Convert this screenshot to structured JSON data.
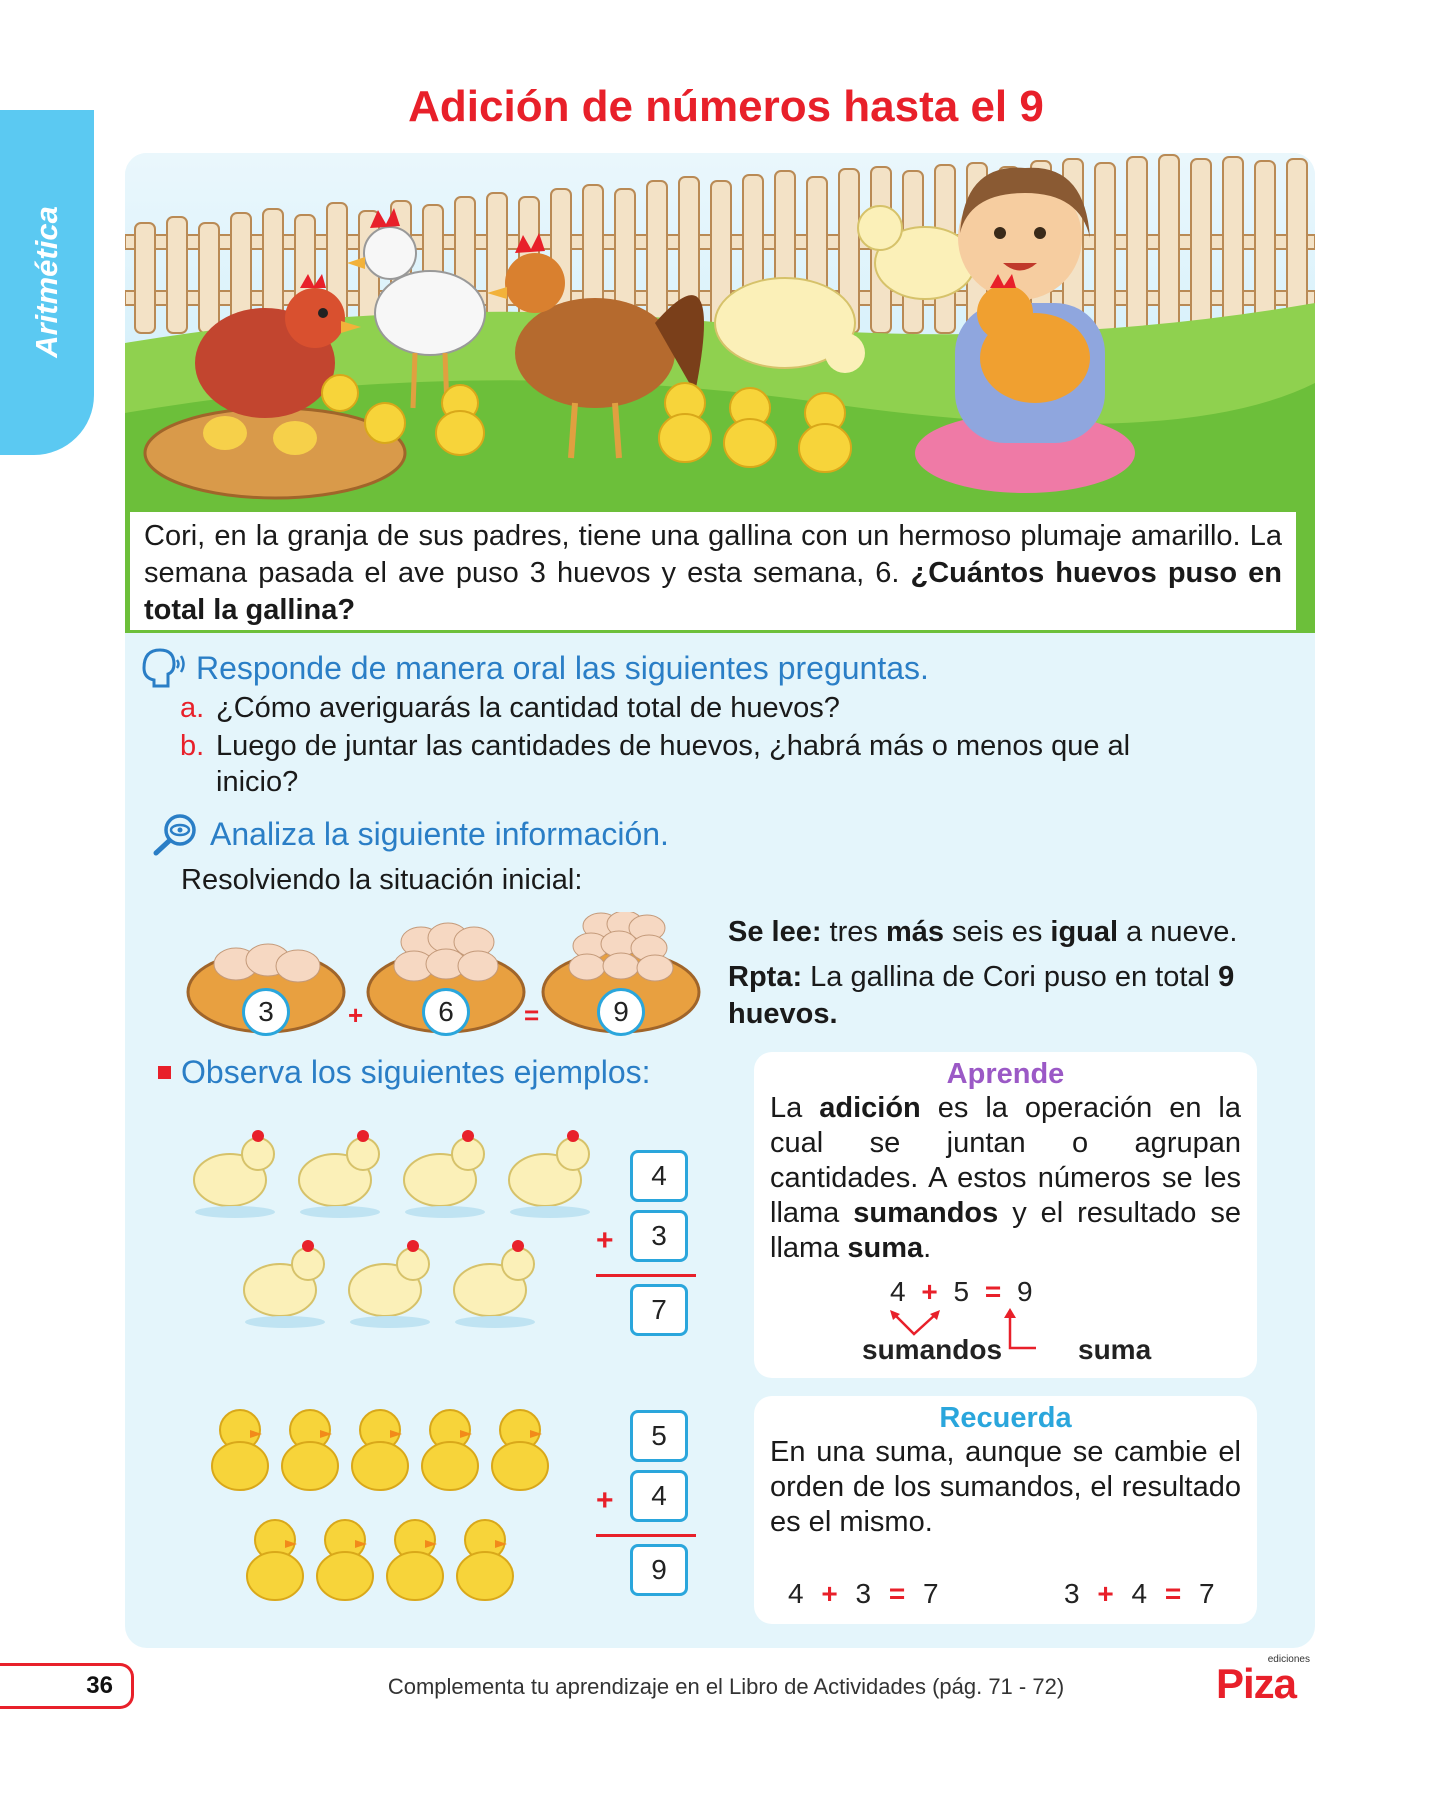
{
  "sidebar": {
    "label": "Aritmética"
  },
  "title": "Adición de números hasta el 9",
  "story": {
    "text_plain": "Cori, en la granja de sus padres, tiene una gallina con un hermoso plumaje amarillo. La semana pasada el ave puso 3 huevos y esta semana, 6. ",
    "text_bold": "¿Cuántos huevos puso en total la gallina?"
  },
  "oral": {
    "heading": "Responde de manera oral las siguientes preguntas.",
    "icon": "speaking-head-icon",
    "questions": [
      {
        "letter": "a.",
        "text": "¿Cómo averiguarás la cantidad total de huevos?"
      },
      {
        "letter": "b.",
        "text": "Luego de juntar las cantidades de huevos, ¿habrá más o menos  que al",
        "text2": "inicio?"
      }
    ]
  },
  "analyze": {
    "heading": "Analiza la siguiente información.",
    "icon": "magnifier-eye-icon",
    "subtitle": "Resolviendo la situación inicial:",
    "nests": [
      "3",
      "6",
      "9"
    ],
    "plus": "+",
    "equals": "=",
    "reads_label": "Se lee:",
    "reads_1": " tres ",
    "reads_mas": "más",
    "reads_2": " seis es ",
    "reads_igual": "igual",
    "reads_3": " a nueve.",
    "answer_label": "Rpta:",
    "answer_text": " La gallina de Cori puso en total ",
    "answer_bold": "9 huevos."
  },
  "examples": {
    "heading": "Observa los siguientes ejemplos:",
    "sum1": {
      "a": "4",
      "b": "3",
      "result": "7"
    },
    "sum2": {
      "a": "5",
      "b": "4",
      "result": "9"
    }
  },
  "aprende": {
    "title": "Aprende",
    "p1": "La ",
    "b1": "adición",
    "p2": " es la operación en la cual se juntan o agrupan cantidades. A estos números se les llama ",
    "b2": "sumandos",
    "p3": " y el resultado se llama ",
    "b3": "suma",
    "p4": ".",
    "eq": {
      "a": "4",
      "plus": "+",
      "b": "5",
      "eq": "=",
      "r": "9"
    },
    "label_sumandos": "sumandos",
    "label_suma": "suma"
  },
  "recuerda": {
    "title": "Recuerda",
    "text": "En una suma, aunque se cambie el orden de los sumandos, el resultado es el mismo.",
    "eq1": {
      "a": "4",
      "plus": "+",
      "b": "3",
      "eq": "=",
      "r": "7"
    },
    "eq2": {
      "a": "3",
      "plus": "+",
      "b": "4",
      "eq": "=",
      "r": "7"
    }
  },
  "footer": {
    "page": "36",
    "text": "Complementa tu aprendizaje en el Libro de Actividades (pág. 71 - 72)",
    "logo_small": "ediciones",
    "logo": "Piza"
  },
  "colors": {
    "title": "#e8202a",
    "heading": "#2a7ec6",
    "aprende": "#9b59c6",
    "recuerda": "#2aa6dc",
    "tab": "#5bc9f2"
  }
}
